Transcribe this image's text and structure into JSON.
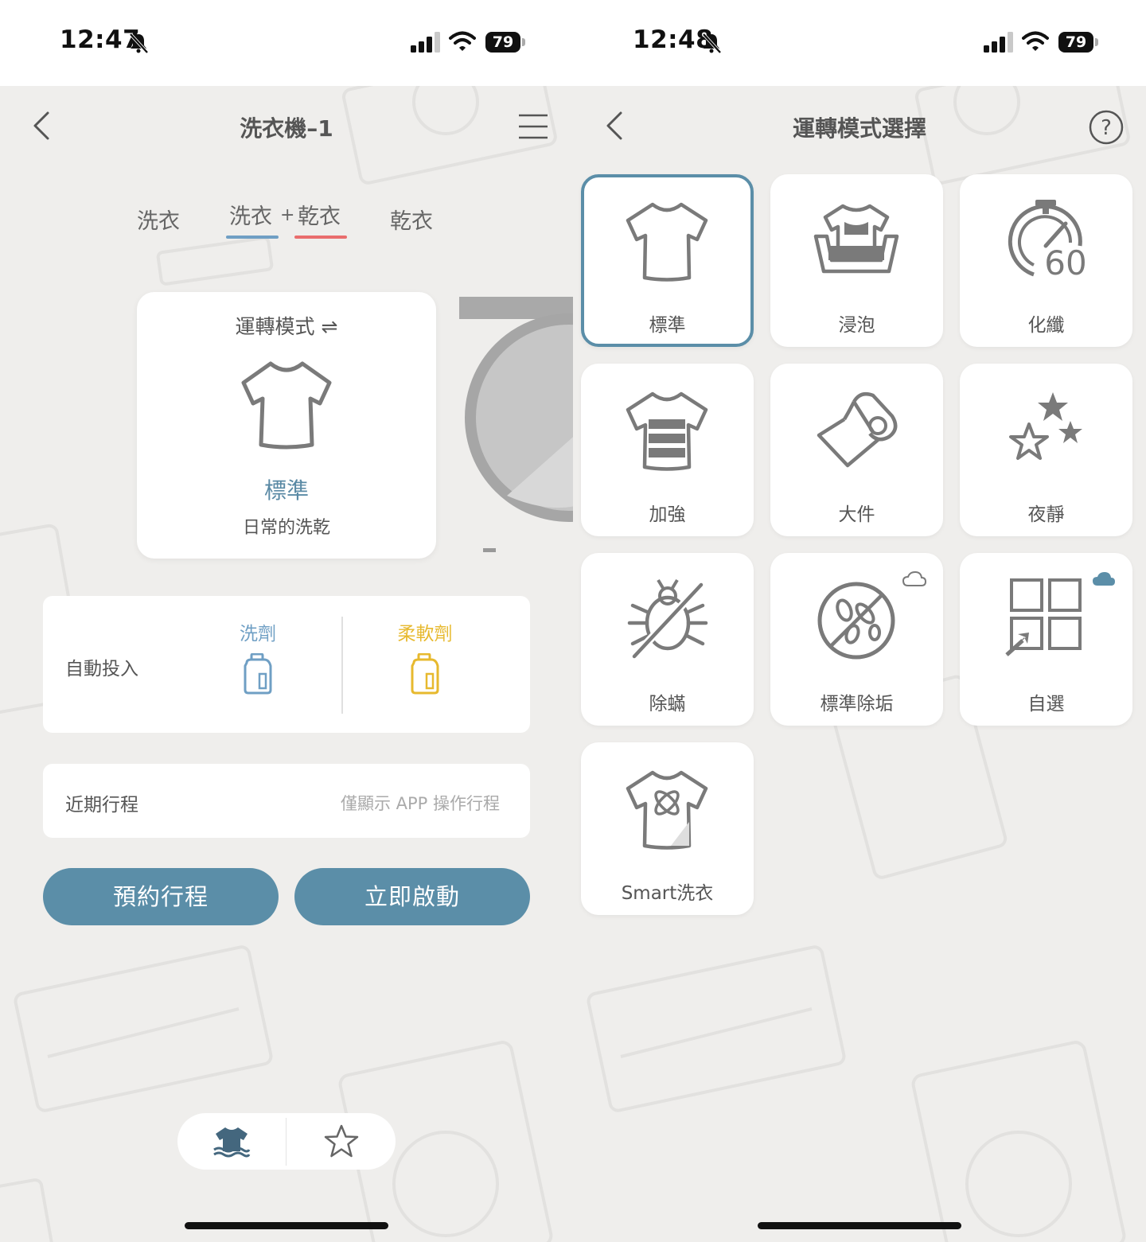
{
  "left_screen": {
    "status": {
      "time": "12:47",
      "battery": "79"
    },
    "header": {
      "title": "洗衣機–1"
    },
    "tabs": {
      "wash": "洗衣",
      "wash_part": "洗衣",
      "plus": "+",
      "dry_part": "乾衣",
      "dry": "乾衣"
    },
    "mode_card": {
      "title": "運轉模式 ⇌",
      "name": "標準",
      "desc": "日常的洗乾"
    },
    "auto_dispense": {
      "label": "自動投入",
      "detergent": "洗劑",
      "softener": "柔軟劑"
    },
    "recent": {
      "label": "近期行程",
      "note": "僅顯示 APP 操作行程"
    },
    "buttons": {
      "schedule": "預約行程",
      "start": "立即啟動"
    }
  },
  "right_screen": {
    "status": {
      "time": "12:48",
      "battery": "79"
    },
    "header": {
      "title": "運轉模式選擇"
    },
    "modes": [
      {
        "label": "標準",
        "icon": "tshirt-icon"
      },
      {
        "label": "浸泡",
        "icon": "soak-icon"
      },
      {
        "label": "化纖",
        "icon": "timer-60-icon"
      },
      {
        "label": "加強",
        "icon": "heavy-shirt-icon"
      },
      {
        "label": "大件",
        "icon": "towel-roll-icon"
      },
      {
        "label": "夜靜",
        "icon": "stars-icon"
      },
      {
        "label": "除蟎",
        "icon": "no-mite-icon"
      },
      {
        "label": "標準除垢",
        "icon": "bacteria-icon"
      },
      {
        "label": "自選",
        "icon": "custom-grid-icon"
      },
      {
        "label": "Smart洗衣",
        "icon": "smart-shirt-icon"
      }
    ],
    "selected_index": 0
  },
  "colors": {
    "accent": "#5b8ea8",
    "detergent": "#6f9fc4",
    "softener": "#e7b92e",
    "wash_underline": "#6f9fc4",
    "dry_underline": "#e96d6d",
    "background": "#efeeec"
  }
}
